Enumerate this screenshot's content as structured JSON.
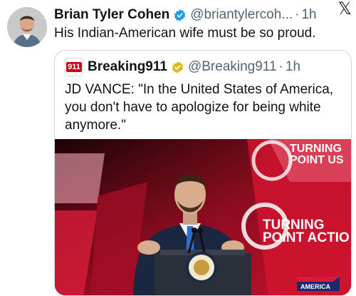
{
  "tweet": {
    "author_name": "Brian Tyler Cohen",
    "handle": "@briantylercoh...",
    "separator": "·",
    "time": "1h",
    "text": "His Indian-American wife must be so proud."
  },
  "quoted_tweet": {
    "avatar_text": "911",
    "author_name": "Breaking911",
    "handle": "@Breaking911",
    "separator": "·",
    "time": "1h",
    "text": "JD VANCE: \"In the United States of America, you don't have to apologize for being white anymore.\"",
    "media": {
      "backdrop_text_top_1": "TURNING",
      "backdrop_text_top_2": "POINT US",
      "backdrop_text_mid_1": "TURNING",
      "backdrop_text_mid_2": "POINT ACTIO",
      "corner_logo_text": "AMERICA"
    }
  },
  "icons": {
    "verified_blue": "#1d9bf0",
    "verified_gold": "#e2b719",
    "x_logo": "𝕏"
  },
  "colors": {
    "text_primary": "#0f1419",
    "text_secondary": "#536471",
    "border": "#cfd9de",
    "stage_red": "#c8102e"
  }
}
